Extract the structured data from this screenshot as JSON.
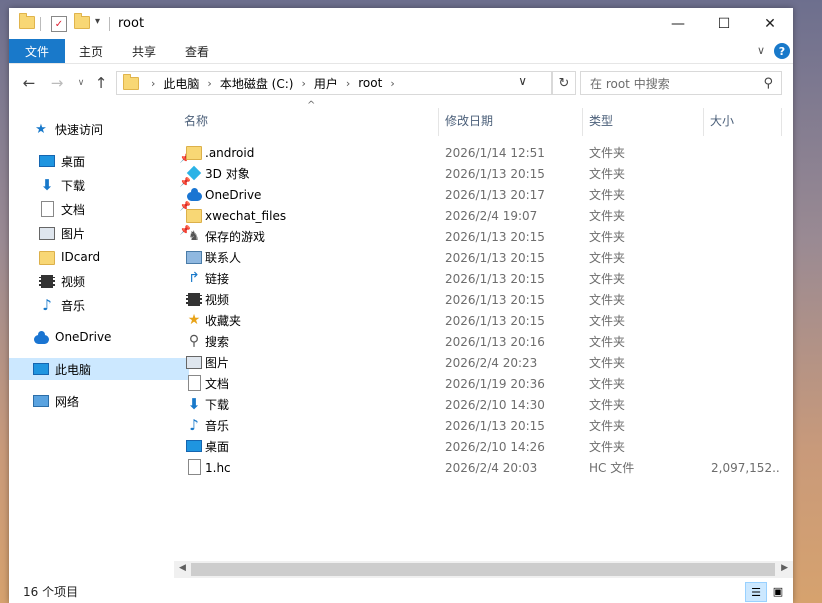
{
  "window": {
    "title": "root",
    "controls": {
      "minimize": "—",
      "maximize": "☐",
      "close": "✕"
    }
  },
  "ribbon": {
    "file_tab": "文件",
    "tabs": [
      "主页",
      "共享",
      "查看"
    ],
    "help": "?"
  },
  "address": {
    "crumbs": [
      "此电脑",
      "本地磁盘 (C:)",
      "用户",
      "root"
    ],
    "search_placeholder": "在 root 中搜索"
  },
  "nav_pane": {
    "quick_access": "快速访问",
    "quick_items": [
      {
        "label": "桌面",
        "icon": "desktop-icon",
        "pinned": true
      },
      {
        "label": "下载",
        "icon": "download-icon",
        "pinned": true
      },
      {
        "label": "文档",
        "icon": "documents-icon",
        "pinned": true
      },
      {
        "label": "图片",
        "icon": "pictures-icon",
        "pinned": true
      },
      {
        "label": "IDcard",
        "icon": "folder-icon",
        "pinned": false
      },
      {
        "label": "视频",
        "icon": "videos-icon",
        "pinned": false
      },
      {
        "label": "音乐",
        "icon": "music-icon",
        "pinned": false
      }
    ],
    "onedrive": "OneDrive",
    "this_pc": "此电脑",
    "network": "网络"
  },
  "columns": {
    "name": "名称",
    "date": "修改日期",
    "type": "类型",
    "size": "大小"
  },
  "files": [
    {
      "name": ".android",
      "date": "2026/1/14 12:51",
      "type": "文件夹",
      "size": "",
      "icon": "folder-icon"
    },
    {
      "name": "3D 对象",
      "date": "2026/1/13 20:15",
      "type": "文件夹",
      "size": "",
      "icon": "3d-objects-icon"
    },
    {
      "name": "OneDrive",
      "date": "2026/1/13 20:17",
      "type": "文件夹",
      "size": "",
      "icon": "onedrive-icon"
    },
    {
      "name": "xwechat_files",
      "date": "2026/2/4 19:07",
      "type": "文件夹",
      "size": "",
      "icon": "folder-icon"
    },
    {
      "name": "保存的游戏",
      "date": "2026/1/13 20:15",
      "type": "文件夹",
      "size": "",
      "icon": "saved-games-icon"
    },
    {
      "name": "联系人",
      "date": "2026/1/13 20:15",
      "type": "文件夹",
      "size": "",
      "icon": "contacts-icon"
    },
    {
      "name": "链接",
      "date": "2026/1/13 20:15",
      "type": "文件夹",
      "size": "",
      "icon": "links-icon"
    },
    {
      "name": "视频",
      "date": "2026/1/13 20:15",
      "type": "文件夹",
      "size": "",
      "icon": "videos-icon"
    },
    {
      "name": "收藏夹",
      "date": "2026/1/13 20:15",
      "type": "文件夹",
      "size": "",
      "icon": "favorites-icon"
    },
    {
      "name": "搜索",
      "date": "2026/1/13 20:16",
      "type": "文件夹",
      "size": "",
      "icon": "searches-icon"
    },
    {
      "name": "图片",
      "date": "2026/2/4 20:23",
      "type": "文件夹",
      "size": "",
      "icon": "pictures-icon"
    },
    {
      "name": "文档",
      "date": "2026/1/19 20:36",
      "type": "文件夹",
      "size": "",
      "icon": "documents-icon"
    },
    {
      "name": "下载",
      "date": "2026/2/10 14:30",
      "type": "文件夹",
      "size": "",
      "icon": "download-icon"
    },
    {
      "name": "音乐",
      "date": "2026/1/13 20:15",
      "type": "文件夹",
      "size": "",
      "icon": "music-icon"
    },
    {
      "name": "桌面",
      "date": "2026/2/10 14:26",
      "type": "文件夹",
      "size": "",
      "icon": "desktop-icon"
    },
    {
      "name": "1.hc",
      "date": "2026/2/4 20:03",
      "type": "HC 文件",
      "size": "2,097,152...",
      "icon": "file-icon"
    }
  ],
  "status": {
    "item_count": "16 个项目"
  },
  "colors": {
    "accent": "#1979ca",
    "selection": "#cce8ff",
    "folder": "#f8d775"
  }
}
